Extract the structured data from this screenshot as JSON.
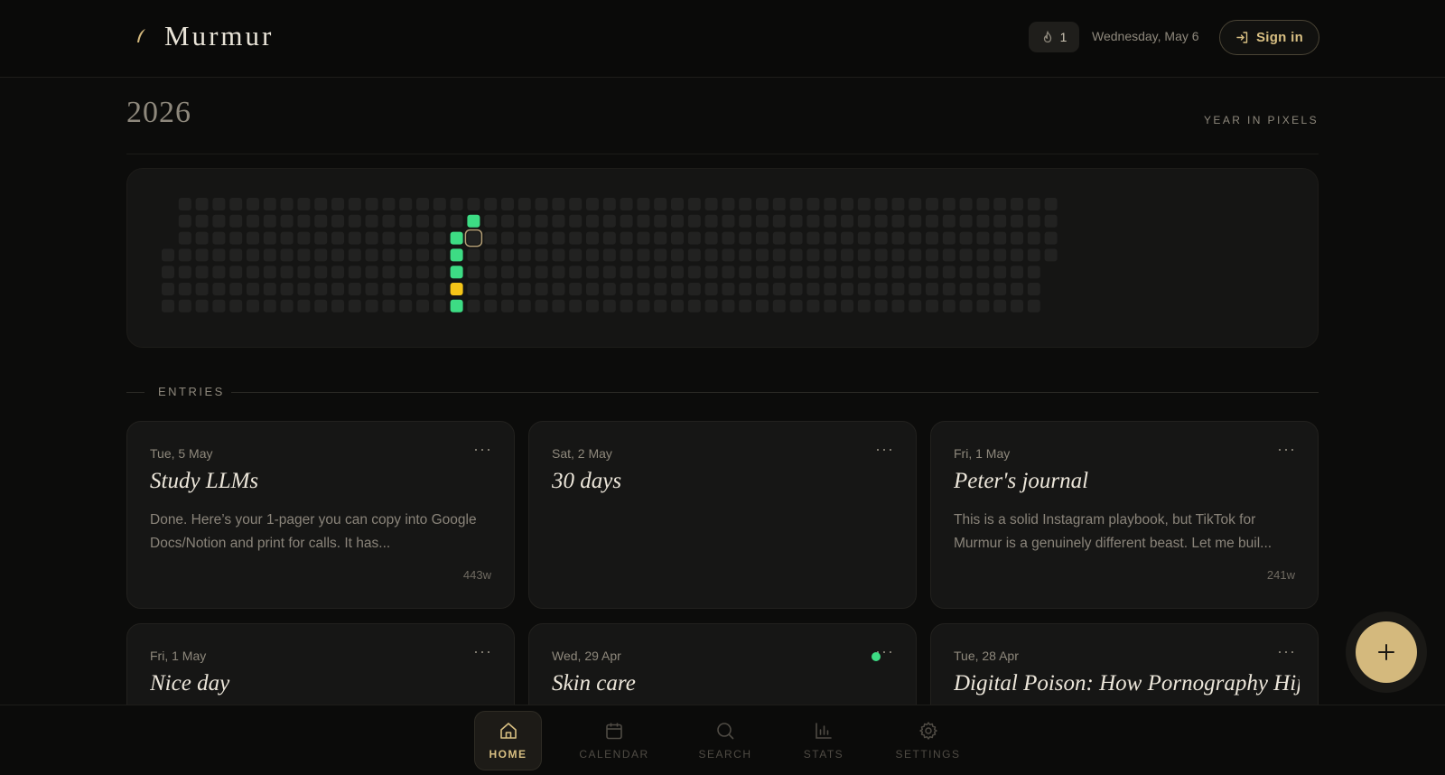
{
  "header": {
    "app_name": "Murmur",
    "streak_count": "1",
    "date": "Wednesday, May 6",
    "signin_label": "Sign in"
  },
  "year": {
    "title": "2026",
    "view_label": "YEAR IN PIXELS"
  },
  "pixels": {
    "colors": {
      "empty": "#222221",
      "green": "#3ddc84",
      "yellow": "#f5c518",
      "today_outline": "#b49f76"
    },
    "filled": [
      {
        "date": "2026-04-29",
        "mood": "green"
      },
      {
        "date": "2026-04-30",
        "mood": "green"
      },
      {
        "date": "2026-05-01",
        "mood": "green"
      },
      {
        "date": "2026-05-02",
        "mood": "yellow"
      },
      {
        "date": "2026-05-03",
        "mood": "green"
      },
      {
        "date": "2026-05-05",
        "mood": "green"
      }
    ],
    "today": "2026-05-06"
  },
  "entries": {
    "heading": "ENTRIES",
    "items": [
      {
        "date": "Tue, 5 May",
        "title": "Study LLMs",
        "excerpt": "Done. Here’s your 1-pager you can copy into Google Docs/Notion and print for calls. It has...",
        "words": "443w",
        "dot": false
      },
      {
        "date": "Sat, 2 May",
        "title": "30 days",
        "excerpt": "",
        "words": "",
        "dot": false
      },
      {
        "date": "Fri, 1 May",
        "title": "Peter's journal",
        "excerpt": "This is a solid Instagram playbook, but TikTok for Murmur is a genuinely different beast. Let me buil...",
        "words": "241w",
        "dot": false
      },
      {
        "date": "Fri, 1 May",
        "title": "Nice day",
        "excerpt": "",
        "words": "",
        "dot": false
      },
      {
        "date": "Wed, 29 Apr",
        "title": "Skin care",
        "excerpt": "",
        "words": "",
        "dot": true
      },
      {
        "date": "Tue, 28 Apr",
        "title": "Digital Poison: How Pornography Hijacked",
        "excerpt": "",
        "words": "",
        "dot": false
      }
    ],
    "menu_glyph": "···"
  },
  "nav": {
    "items": [
      {
        "label": "HOME",
        "icon": "home-icon",
        "active": true
      },
      {
        "label": "CALENDAR",
        "icon": "calendar-icon",
        "active": false
      },
      {
        "label": "SEARCH",
        "icon": "search-icon",
        "active": false
      },
      {
        "label": "STATS",
        "icon": "stats-icon",
        "active": false
      },
      {
        "label": "SETTINGS",
        "icon": "gear-icon",
        "active": false
      }
    ]
  },
  "fab": {
    "icon": "plus-icon"
  }
}
